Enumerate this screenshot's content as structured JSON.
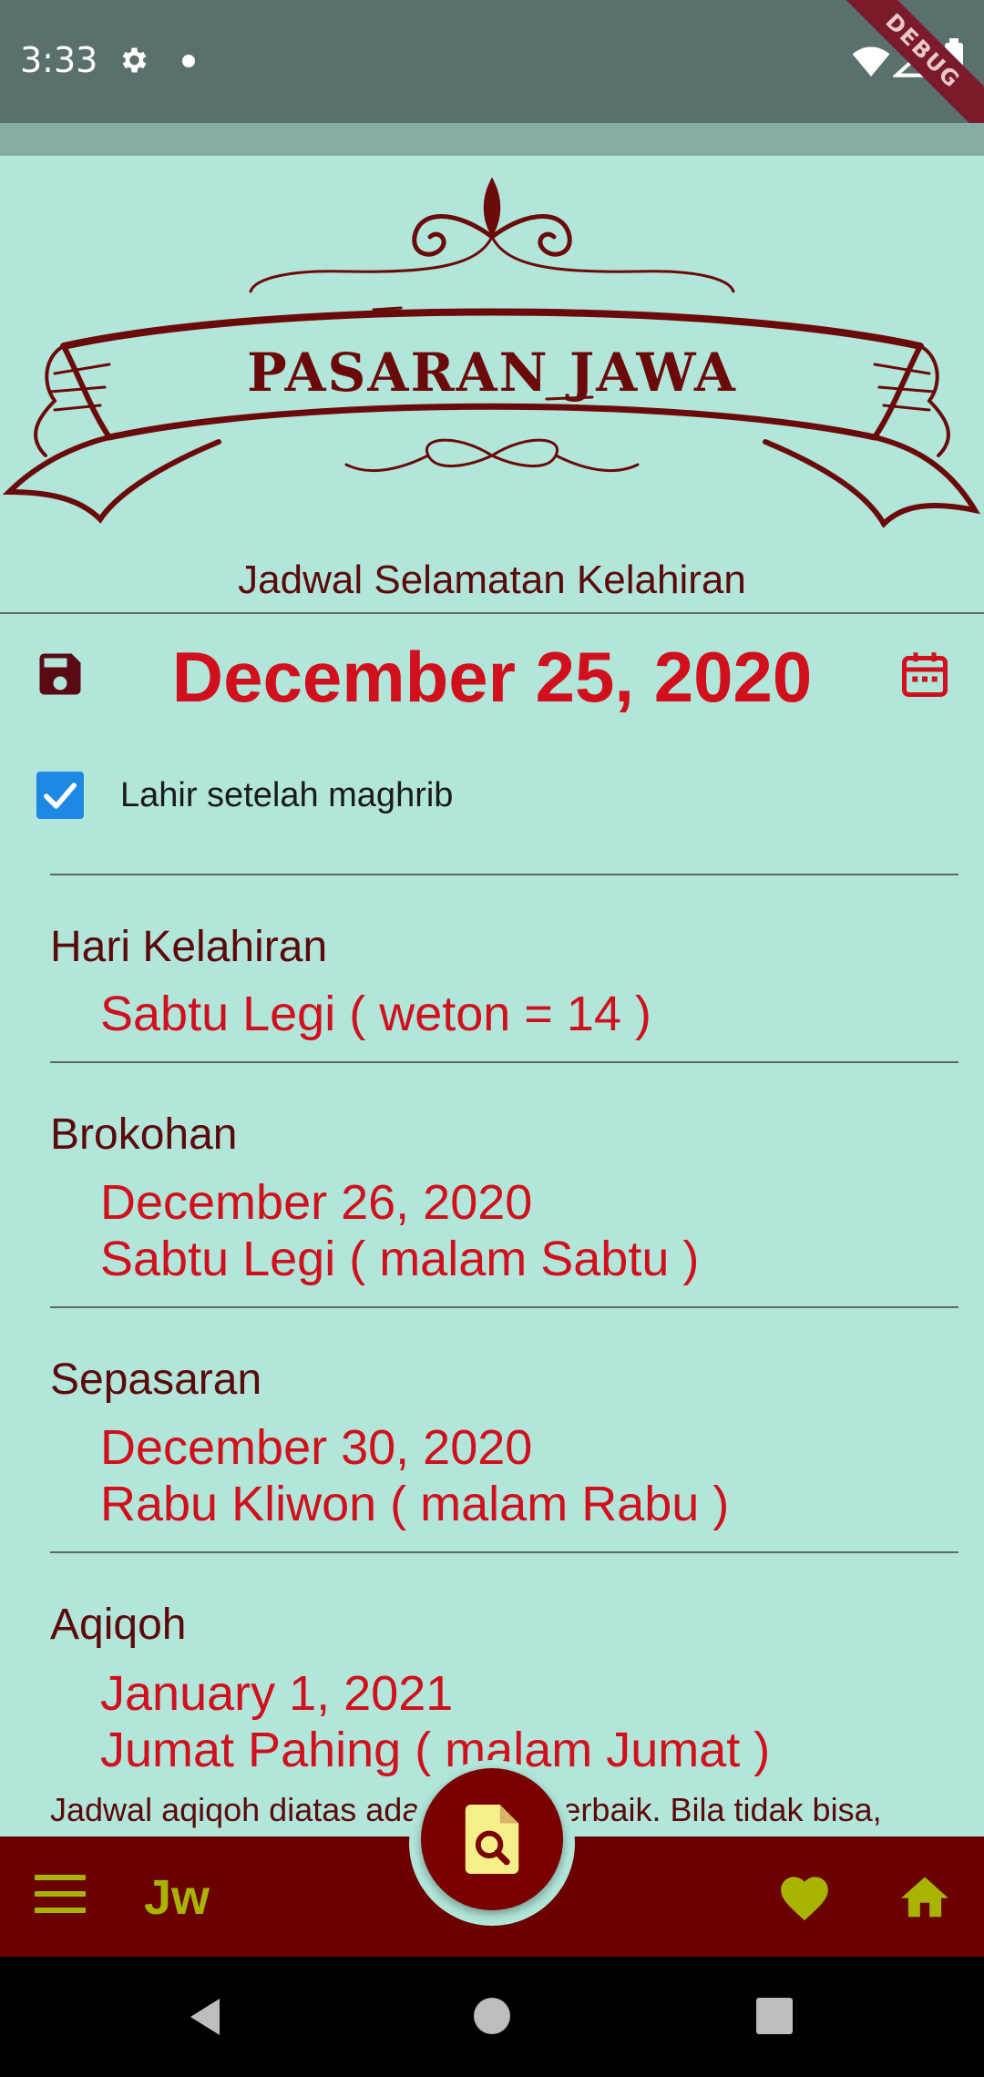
{
  "status_bar": {
    "time": "3:33",
    "debug_label": "DEBUG"
  },
  "header": {
    "banner_title": "PASARAN JAWA",
    "subtitle": "Jadwal Selamatan Kelahiran"
  },
  "date_row": {
    "date": "December 25, 2020"
  },
  "checkbox": {
    "label": "Lahir setelah maghrib",
    "checked": true
  },
  "sections": [
    {
      "title": "Hari Kelahiran",
      "line1": "Sabtu Legi ( weton = 14 )",
      "line2": ""
    },
    {
      "title": "Brokohan",
      "line1": "December 26, 2020",
      "line2": "Sabtu Legi ( malam Sabtu )"
    },
    {
      "title": "Sepasaran",
      "line1": "December 30, 2020",
      "line2": "Rabu Kliwon ( malam Rabu )"
    },
    {
      "title": "Aqiqoh",
      "line1": "January 1, 2021",
      "line2": "Jumat Pahing ( malam Jumat )"
    }
  ],
  "note": "Jadwal aqiqoh diatas adalah yang terbaik. Bila tidak bisa,",
  "bottom_bar": {
    "jw_label": "Jw"
  },
  "colors": {
    "background": "#b2e6da",
    "accent_red": "#d0101c",
    "maroon": "#6b0000",
    "olive": "#a8b400",
    "checkbox_blue": "#1e88e5"
  },
  "icons": [
    "settings-icon",
    "wifi-icon",
    "signal-icon",
    "battery-icon",
    "save-icon",
    "calendar-icon",
    "menu-icon",
    "heart-icon",
    "home-icon",
    "search-document-icon"
  ]
}
